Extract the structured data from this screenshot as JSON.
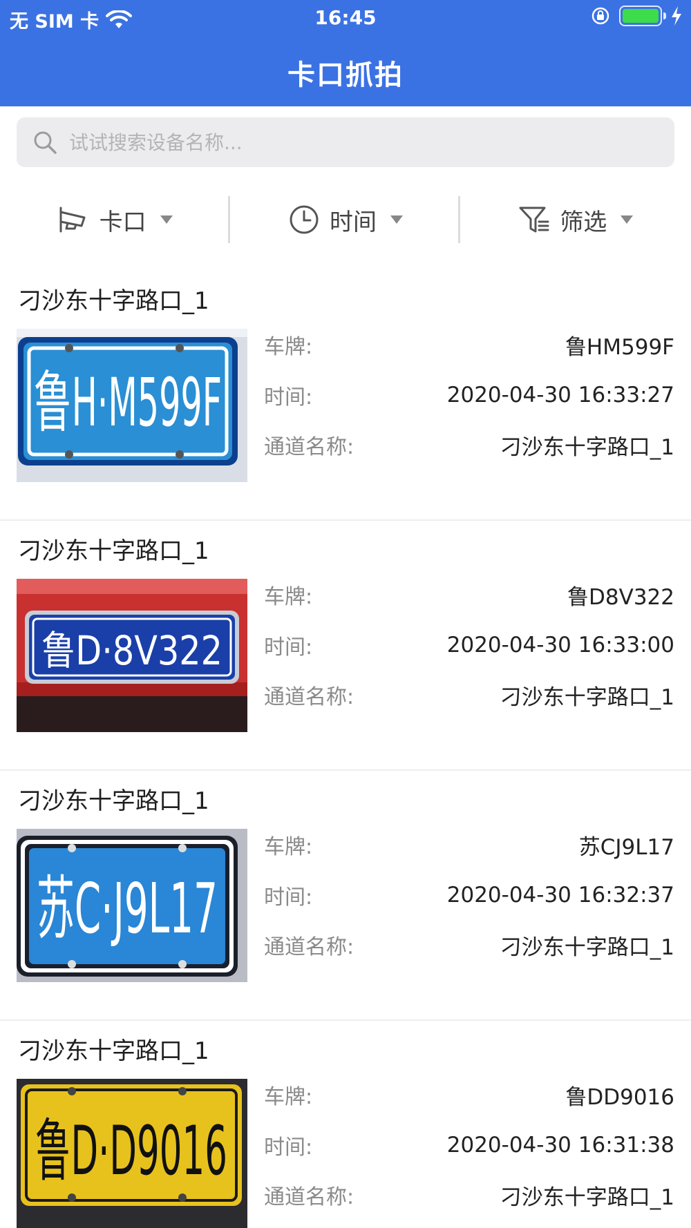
{
  "status_bar": {
    "carrier": "无 SIM 卡",
    "time": "16:45",
    "battery_percent": 100,
    "charging": true
  },
  "header": {
    "title": "卡口抓拍",
    "color": "#3b72e3"
  },
  "search": {
    "placeholder": "试试搜索设备名称...",
    "value": ""
  },
  "filters": [
    {
      "label": "卡口",
      "icon": "camera-icon"
    },
    {
      "label": "时间",
      "icon": "clock-icon"
    },
    {
      "label": "筛选",
      "icon": "filter-icon"
    }
  ],
  "labels": {
    "plate": "车牌:",
    "time": "时间:",
    "channel": "通道名称:"
  },
  "records": [
    {
      "title": "刁沙东十字路口_1",
      "plate": "鲁HM599F",
      "time": "2020-04-30 16:33:27",
      "channel": "刁沙东十字路口_1",
      "image_text": "鲁H·M599F",
      "plate_color": "blue"
    },
    {
      "title": "刁沙东十字路口_1",
      "plate": "鲁D8V322",
      "time": "2020-04-30 16:33:00",
      "channel": "刁沙东十字路口_1",
      "image_text": "鲁D·8V322",
      "plate_color": "blue"
    },
    {
      "title": "刁沙东十字路口_1",
      "plate": "苏CJ9L17",
      "time": "2020-04-30 16:32:37",
      "channel": "刁沙东十字路口_1",
      "image_text": "苏C·J9L17",
      "plate_color": "blue"
    },
    {
      "title": "刁沙东十字路口_1",
      "plate": "鲁DD9016",
      "time": "2020-04-30 16:31:38",
      "channel": "刁沙东十字路口_1",
      "image_text": "鲁D·D9016",
      "plate_color": "yellow"
    }
  ]
}
